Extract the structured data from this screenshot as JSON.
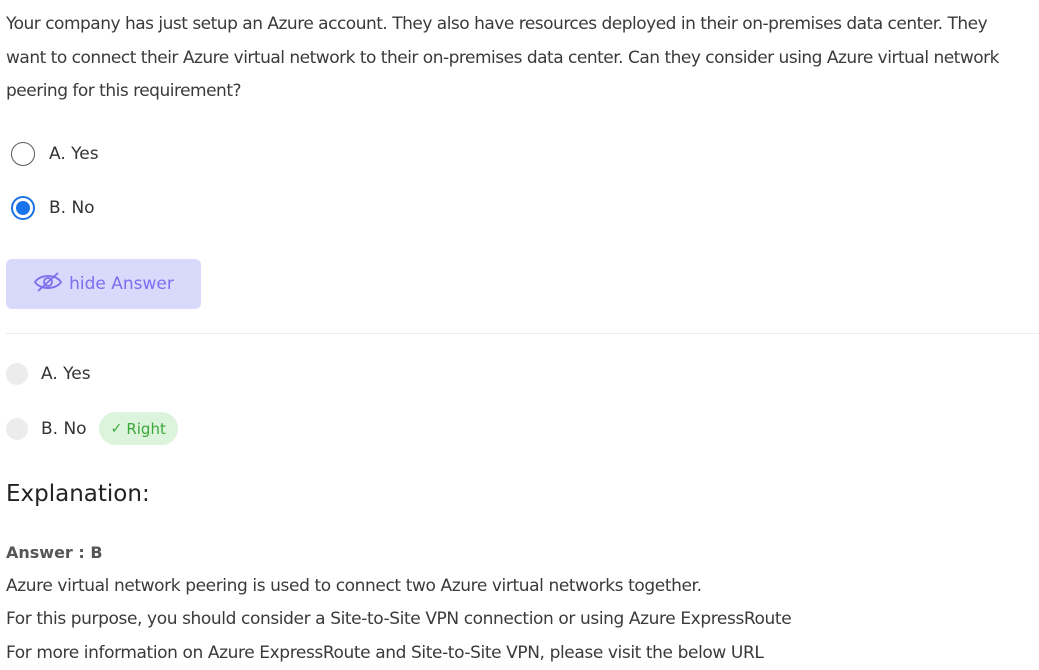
{
  "question": {
    "text": "Your company has just setup an Azure account. They also have resources deployed in their on-premises data center. They want to connect their Azure virtual network to their on-premises data center. Can they consider using Azure virtual network peering for this requirement?"
  },
  "options": [
    {
      "label": "A. Yes",
      "selected": false
    },
    {
      "label": "B. No",
      "selected": true
    }
  ],
  "hide_button": {
    "label": "hide Answer",
    "icon": "eye-off-icon"
  },
  "answer_options": [
    {
      "label": "A. Yes"
    },
    {
      "label": "B. No",
      "badge": "Right"
    }
  ],
  "explanation": {
    "title": "Explanation:",
    "answer": "Answer : B",
    "lines": [
      "Azure virtual network peering is used to connect two Azure virtual networks together.",
      "For this purpose, you should consider a Site-to-Site VPN connection or using Azure ExpressRoute",
      "For more information on Azure ExpressRoute and Site-to-Site VPN, please visit the below URL"
    ]
  },
  "colors": {
    "radio_selected": "#1a73e8",
    "button_bg": "#d9d9fb",
    "button_text": "#7a6ff0",
    "badge_bg": "#dcf3dc",
    "badge_text": "#3aa83a"
  }
}
